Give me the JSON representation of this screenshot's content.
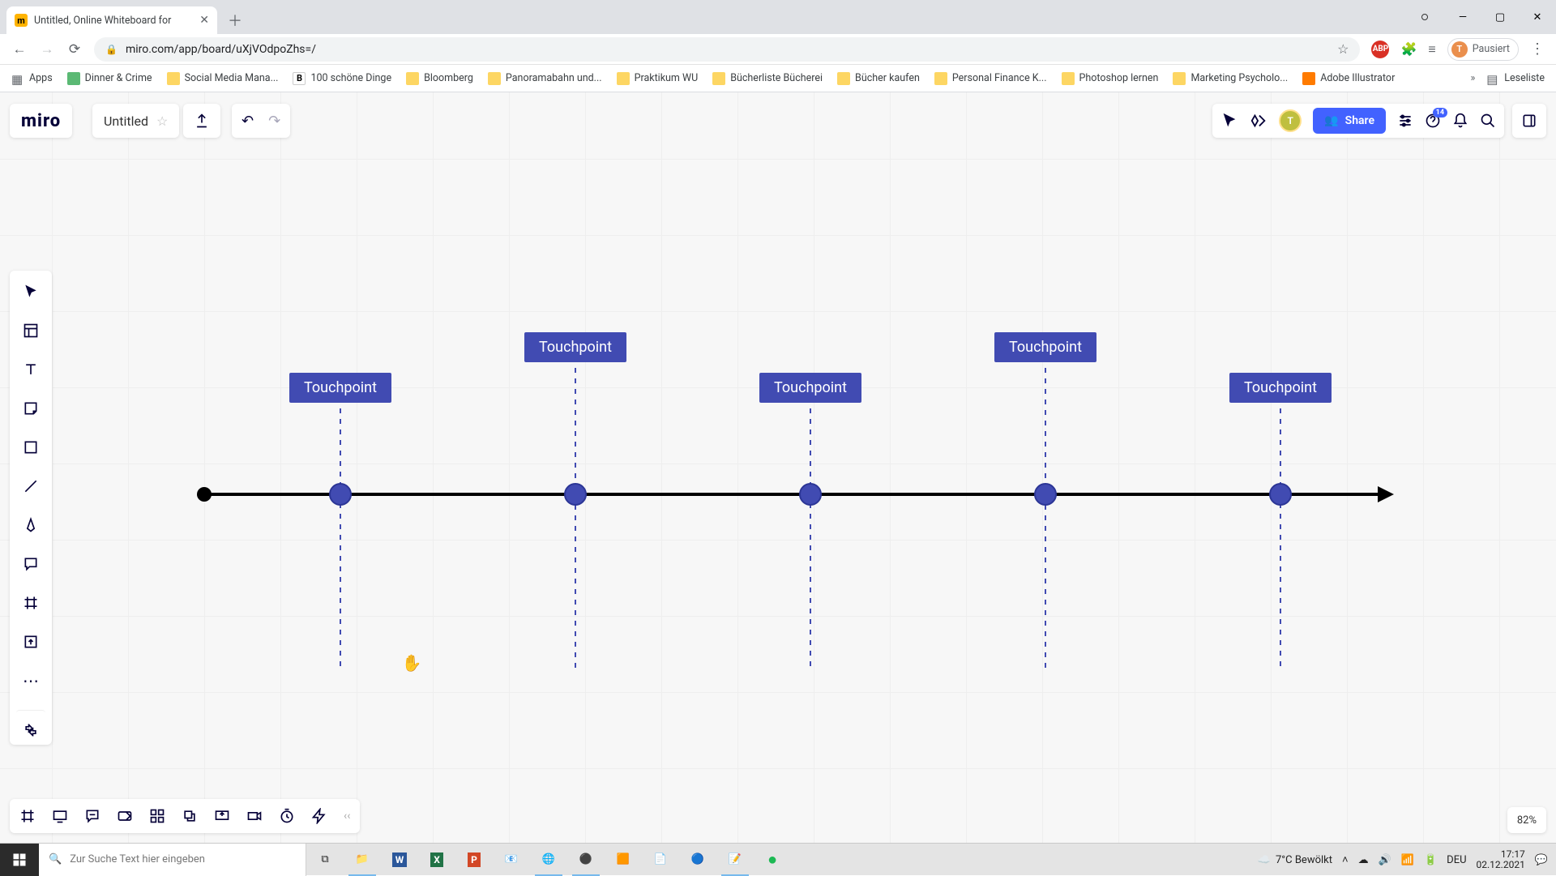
{
  "browser": {
    "tab_title": "Untitled, Online Whiteboard for",
    "url": "miro.com/app/board/uXjVOdpoZhs=/",
    "profile_status": "Pausiert",
    "bookmarks": [
      "Apps",
      "Dinner & Crime",
      "Social Media Mana...",
      "100 schöne Dinge",
      "Bloomberg",
      "Panoramabahn und...",
      "Praktikum WU",
      "Bücherliste Bücherei",
      "Bücher kaufen",
      "Personal Finance K...",
      "Photoshop lernen",
      "Marketing Psycholo...",
      "Adobe Illustrator"
    ],
    "reading_list": "Leseliste"
  },
  "miro": {
    "logo": "miro",
    "board_name": "Untitled",
    "share_label": "Share",
    "avatar_initial": "T",
    "notification_count": "14",
    "zoom": "82%"
  },
  "timeline": {
    "labels": [
      "Touchpoint",
      "Touchpoint",
      "Touchpoint",
      "Touchpoint",
      "Touchpoint"
    ]
  },
  "taskbar": {
    "search_placeholder": "Zur Suche Text hier eingeben",
    "weather": "7°C  Bewölkt",
    "time": "17:17",
    "date": "02.12.2021",
    "lang": "DEU"
  }
}
